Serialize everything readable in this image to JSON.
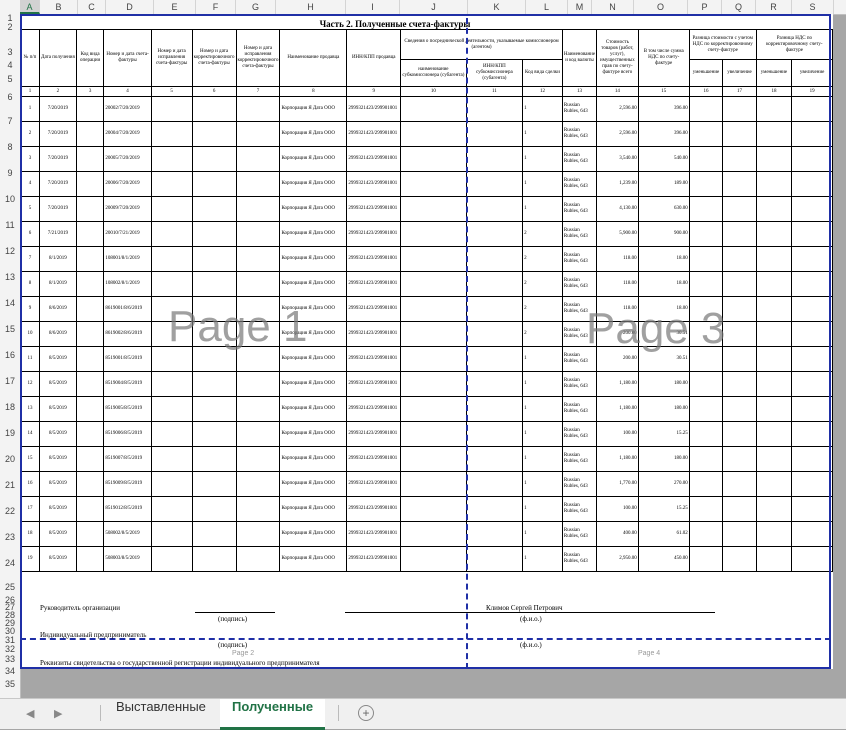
{
  "columns": [
    "A",
    "B",
    "C",
    "D",
    "E",
    "F",
    "G",
    "H",
    "I",
    "J",
    "K",
    "L",
    "M",
    "N",
    "O",
    "P",
    "Q",
    "R",
    "S"
  ],
  "selected_column": "A",
  "rows": [
    "1",
    "2",
    "3",
    "4",
    "5",
    "6",
    "7",
    "8",
    "9",
    "10",
    "11",
    "12",
    "13",
    "14",
    "15",
    "16",
    "17",
    "18",
    "19",
    "20",
    "21",
    "22",
    "23",
    "24",
    "25",
    "26",
    "27",
    "28",
    "29",
    "30",
    "31",
    "32",
    "33",
    "34",
    "35"
  ],
  "sheet": {
    "title": "Часть 2. Полученные счета-фактуры",
    "headers": {
      "a": "№ п/п",
      "b": "Дата получения",
      "c": "Код вида операции",
      "d": "Номер и дата счета-фактуры",
      "e": "Номер и дата исправления счета-фактуры",
      "f": "Номер и дата корректировочного счета-фактуры",
      "g": "Номер и дата исправления корректировочного счета-фактуры",
      "h": "Наименование продавца",
      "i": "ИНН/КПП продавца",
      "jk_top": "Сведения о посреднической деятельности, указываемые комиссионером (агентом)",
      "j_sub": "наименование субкомиссионера (субагента)",
      "k_sub": "ИНН/КПП субкомиссионера (субагента)",
      "l": "Код вида сделки",
      "m": "Наименование и код валюты",
      "n": "Стоимость товаров (работ, услуг), имущественных прав по счету-фактуре всего",
      "o": "В том числе сумма НДС по счету-фактуре",
      "pq_top": "Разница стоимости с учетом НДС по корректировочному счету-фактуре",
      "rs_top": "Разница НДС по корректировочному счету-фактуре",
      "dec": "уменьшение",
      "inc": "увеличение"
    },
    "col_numbers": [
      "1",
      "2",
      "3",
      "4",
      "5",
      "6",
      "7",
      "8",
      "9",
      "10",
      "11",
      "12",
      "13",
      "14",
      "15",
      "16",
      "17",
      "18",
      "19"
    ],
    "seller": "Корпорация Я Дата ООО",
    "inn": "2999321423/299901001",
    "currency": "Russian Rubles, 643",
    "records": [
      {
        "n": "1",
        "date": "7/20/2019",
        "inv": "20002/7/20/2019",
        "code": "1",
        "total": "2,596.00",
        "vat": "396.00"
      },
      {
        "n": "2",
        "date": "7/20/2019",
        "inv": "20004/7/20/2019",
        "code": "1",
        "total": "2,596.00",
        "vat": "396.00"
      },
      {
        "n": "3",
        "date": "7/20/2019",
        "inv": "20005/7/20/2019",
        "code": "1",
        "total": "3,540.00",
        "vat": "540.00"
      },
      {
        "n": "4",
        "date": "7/20/2019",
        "inv": "20006/7/20/2019",
        "code": "1",
        "total": "1,239.00",
        "vat": "189.00"
      },
      {
        "n": "5",
        "date": "7/20/2019",
        "inv": "20009/7/20/2019",
        "code": "1",
        "total": "4,130.00",
        "vat": "630.00"
      },
      {
        "n": "6",
        "date": "7/21/2019",
        "inv": "20010/7/21/2019",
        "code": "2",
        "total": "5,900.00",
        "vat": "900.00"
      },
      {
        "n": "7",
        "date": "8/1/2019",
        "inv": "108001/8/1/2019",
        "code": "2",
        "total": "118.00",
        "vat": "18.00"
      },
      {
        "n": "8",
        "date": "8/1/2019",
        "inv": "108002/8/1/2019",
        "code": "2",
        "total": "118.00",
        "vat": "18.00"
      },
      {
        "n": "9",
        "date": "8/6/2019",
        "inv": "8619001/8/6/2019",
        "code": "2",
        "total": "118.00",
        "vat": "18.00"
      },
      {
        "n": "10",
        "date": "8/6/2019",
        "inv": "8619002/8/6/2019",
        "code": "2",
        "total": "200.00",
        "vat": "30.51"
      },
      {
        "n": "11",
        "date": "8/5/2019",
        "inv": "8519001/8/5/2019",
        "code": "1",
        "total": "200.00",
        "vat": "30.51"
      },
      {
        "n": "12",
        "date": "8/5/2019",
        "inv": "8519004/8/5/2019",
        "code": "1",
        "total": "1,180.00",
        "vat": "180.00"
      },
      {
        "n": "13",
        "date": "8/5/2019",
        "inv": "8519005/8/5/2019",
        "code": "1",
        "total": "1,180.00",
        "vat": "180.00"
      },
      {
        "n": "14",
        "date": "8/5/2019",
        "inv": "8519006/8/5/2019",
        "code": "1",
        "total": "100.00",
        "vat": "15.25"
      },
      {
        "n": "15",
        "date": "8/5/2019",
        "inv": "8519007/8/5/2019",
        "code": "1",
        "total": "1,180.00",
        "vat": "180.00"
      },
      {
        "n": "16",
        "date": "8/5/2019",
        "inv": "8519009/8/5/2019",
        "code": "1",
        "total": "1,770.00",
        "vat": "270.00"
      },
      {
        "n": "17",
        "date": "8/5/2019",
        "inv": "8519012/8/5/2019",
        "code": "1",
        "total": "100.00",
        "vat": "15.25"
      },
      {
        "n": "18",
        "date": "8/5/2019",
        "inv": "508002/8/5/2019",
        "code": "1",
        "total": "400.00",
        "vat": "61.02"
      },
      {
        "n": "19",
        "date": "8/5/2019",
        "inv": "508003/8/5/2019",
        "code": "1",
        "total": "2,950.00",
        "vat": "450.00"
      }
    ],
    "footer": {
      "head": "Руководитель организации",
      "head_name": "Климов Сергей Петрович",
      "sign1": "(подпись)",
      "fio1": "(ф.и.о.)",
      "ip": "Индивидуальный предприниматель",
      "sign2": "(подпись)",
      "fio2": "(ф.и.о.)",
      "rekv": "Реквизиты свидетельства о государственной регистрации индивидуального предпринимателя"
    },
    "watermarks": [
      "Page 1",
      "Page 3"
    ],
    "page_labels": [
      "Page 2",
      "Page 4"
    ]
  },
  "tabs": {
    "prev": "◀",
    "next": "▶",
    "sheet1": "Выставленные",
    "sheet2": "Полученные",
    "add": "+"
  }
}
